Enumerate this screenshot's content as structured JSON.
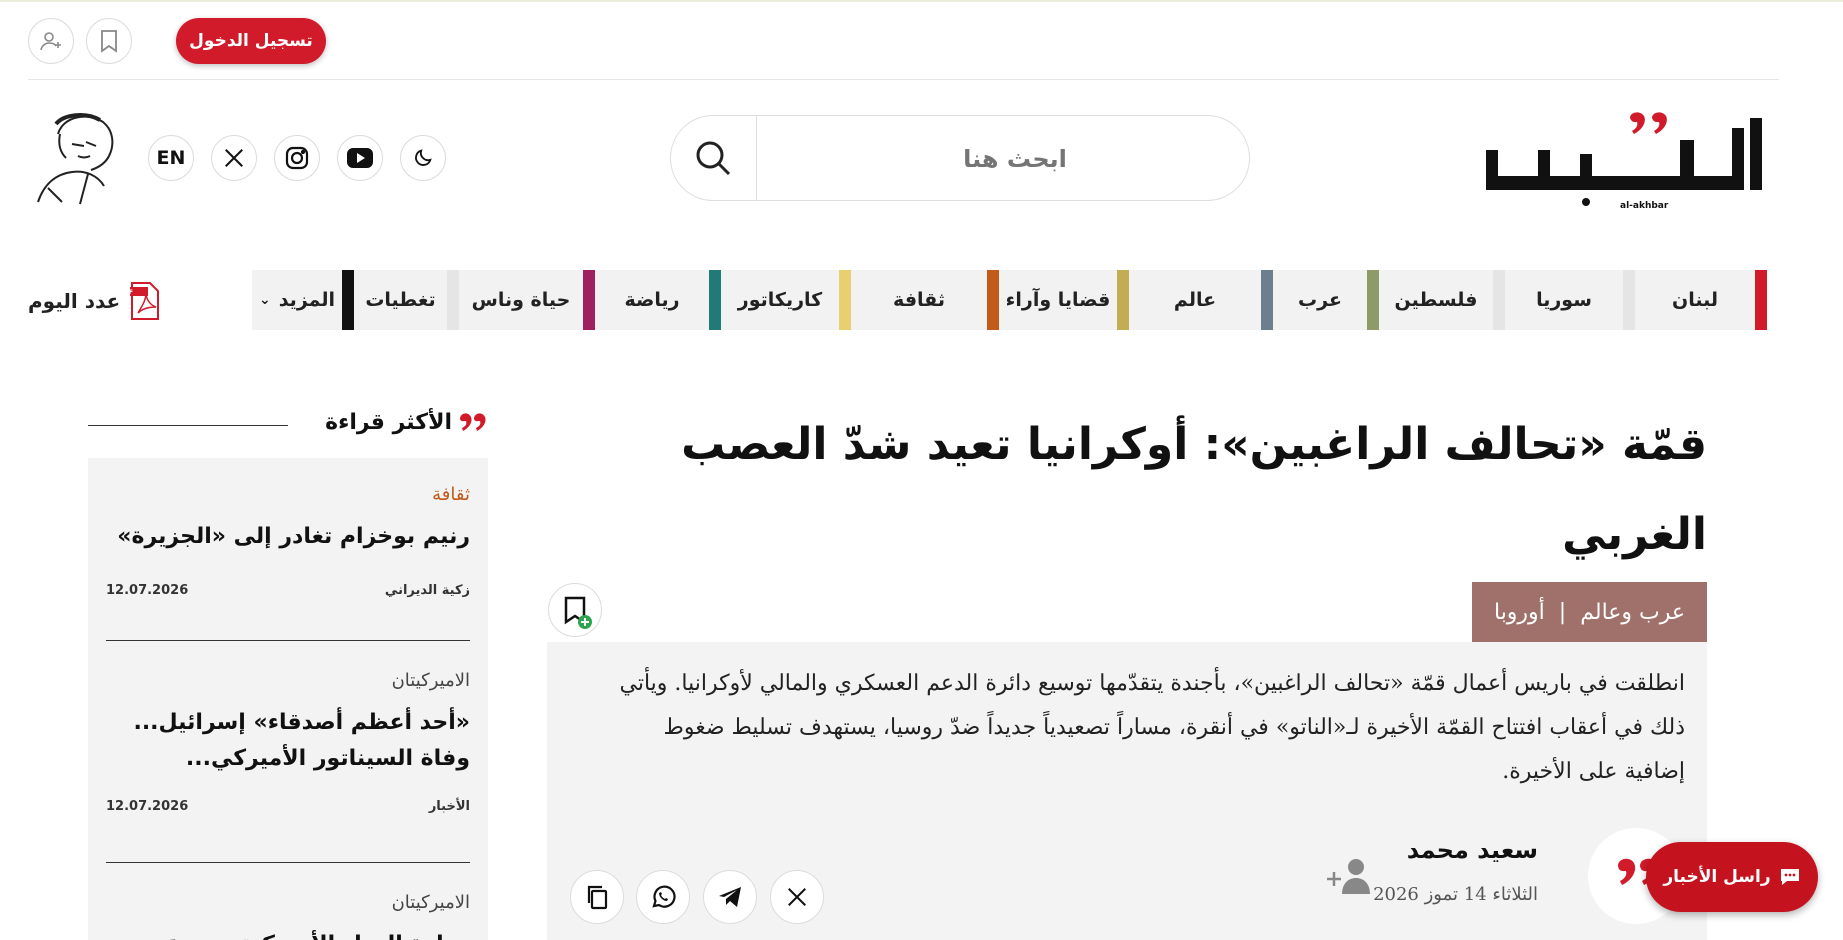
{
  "topbar": {
    "login_label": "تسجيل الدخول"
  },
  "header": {
    "logo_latin": "al-akhbar",
    "search_placeholder": "ابحث هنا",
    "lang_label": "EN"
  },
  "nav": {
    "items": [
      {
        "label": "لبنان",
        "color": "#d11a2a"
      },
      {
        "label": "سوريا",
        "color": "#e5e5e5"
      },
      {
        "label": "فلسطين",
        "color": "#e5e5e5"
      },
      {
        "label": "عرب",
        "color": "#8f9a6a"
      },
      {
        "label": "عالم",
        "color": "#6b7f8f"
      },
      {
        "label": "قضايا وآراء",
        "color": "#c2ad52"
      },
      {
        "label": "ثقافة",
        "color": "#c25a1a"
      },
      {
        "label": "كاريكاتور",
        "color": "#e8d070"
      },
      {
        "label": "رياضة",
        "color": "#1f7a78"
      },
      {
        "label": "حياة وناس",
        "color": "#a0205f"
      },
      {
        "label": "تغطيات",
        "color": "#e5e5e5"
      },
      {
        "label": "المزيد",
        "color": "#111111"
      }
    ],
    "today_label": "عدد اليوم"
  },
  "sidebar": {
    "title": "الأكثر قراءة",
    "items": [
      {
        "category": "ثقافة",
        "category_color": "#c25a1a",
        "headline": "رنيم بوخزام تغادر إلى «الجزيرة»",
        "author": "زكية الديراني",
        "date": "12.07.2026"
      },
      {
        "category": "الاميركيتان",
        "category_color": "#444444",
        "headline": "«أحد أعظم أصدقاء» إسرائيل... وفاة السيناتور الأميركي...",
        "author": "الأخبار",
        "date": "12.07.2026"
      },
      {
        "category": "الاميركيتان",
        "category_color": "#444444",
        "headline": "وزارة العدل الأميركية تستدعي...",
        "author": "",
        "date": ""
      }
    ]
  },
  "article": {
    "title": "قمّة «تحالف الراغبين»: أوكرانيا تعيد شدّ العصب الغربي",
    "tags": [
      "عرب وعالم",
      "|",
      "أوروبا"
    ],
    "summary": "انطلقت في باريس أعمال قمّة «تحالف الراغبين»، بأجندة يتقدّمها توسيع دائرة الدعم العسكري والمالي لأوكرانيا. ويأتي ذلك في أعقاب افتتاح القمّة الأخيرة لـ«الناتو» في أنقرة، مساراً تصعيدياً جديداً ضدّ روسيا، يستهدف تسليط ضغوط إضافية على الأخيرة.",
    "author": "سعيد محمد",
    "date": "الثلاثاء 14 تموز 2026"
  },
  "contact": {
    "label": "راسل الأخبار"
  },
  "colors": {
    "brand_red": "#d11a2a",
    "tag_bg": "#a0716b"
  }
}
